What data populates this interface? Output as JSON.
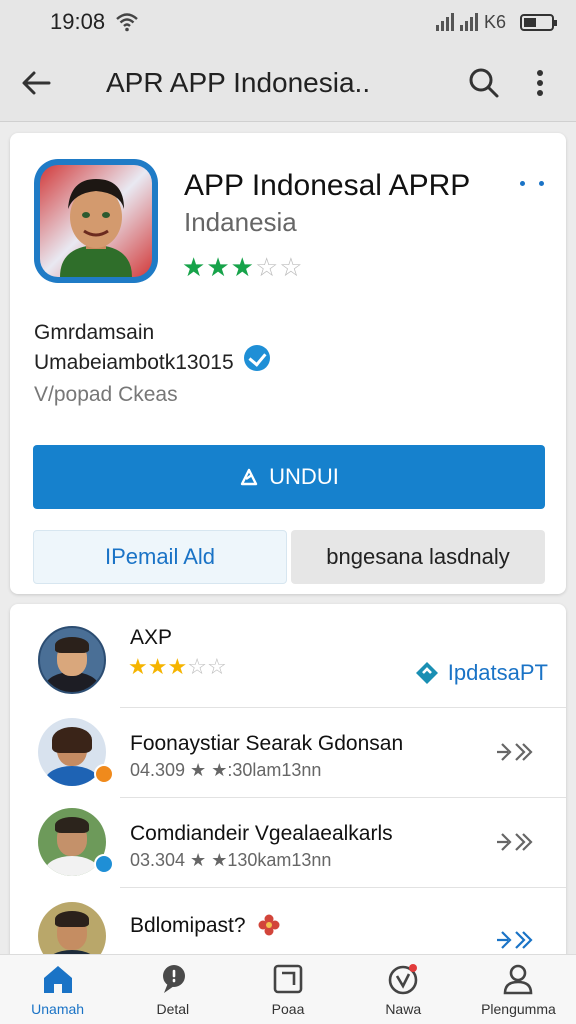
{
  "status": {
    "time": "19:08",
    "network": "K6"
  },
  "app_bar": {
    "title": "APR APP Indonesia..",
    "back_icon": "arrow-left-icon",
    "search_icon": "search-icon",
    "more_icon": "more-vert-icon"
  },
  "app": {
    "name": "APP Indonesal APRP",
    "developer": "Indanesia",
    "rating": 3,
    "rating_max": 5,
    "meta_line1": "Gmrdamsain",
    "meta_line2": "Umabeiambotk13015",
    "meta_line3": "V/popad Ckeas",
    "install_label": "UNDUI",
    "button_left": "IPemail Ald",
    "button_right": "bngesana lasdnaly",
    "accent_color": "#1681cd",
    "star_color": "#17a34a"
  },
  "list": {
    "items": [
      {
        "title": "AXP",
        "rating": 3.5,
        "action": "IpdatsaPT",
        "action_icon": "update-icon"
      },
      {
        "title": "Foonaystiar Searak Gdonsan",
        "subtitle": "04.309 ★ ★:30lam13nn",
        "action_icon": "chevron-right-icon",
        "badge_color": "#f08a1c"
      },
      {
        "title": "Comdiandeir Vgealaealkarls",
        "subtitle": "03.304 ★ ★130kam13nn",
        "action_icon": "chevron-right-icon",
        "badge_color": "#1f8fd6"
      },
      {
        "title": "Bdlomipast?",
        "subtitle": "",
        "action_icon": "chevron-right-icon"
      }
    ]
  },
  "nav": {
    "items": [
      {
        "label": "Unamah",
        "icon": "home-icon",
        "active": true
      },
      {
        "label": "Detal",
        "icon": "detail-icon",
        "active": false
      },
      {
        "label": "Poaa",
        "icon": "apps-icon",
        "active": false
      },
      {
        "label": "Nawa",
        "icon": "news-icon",
        "active": false
      },
      {
        "label": "Plengumma",
        "icon": "profile-icon",
        "active": false
      }
    ]
  }
}
